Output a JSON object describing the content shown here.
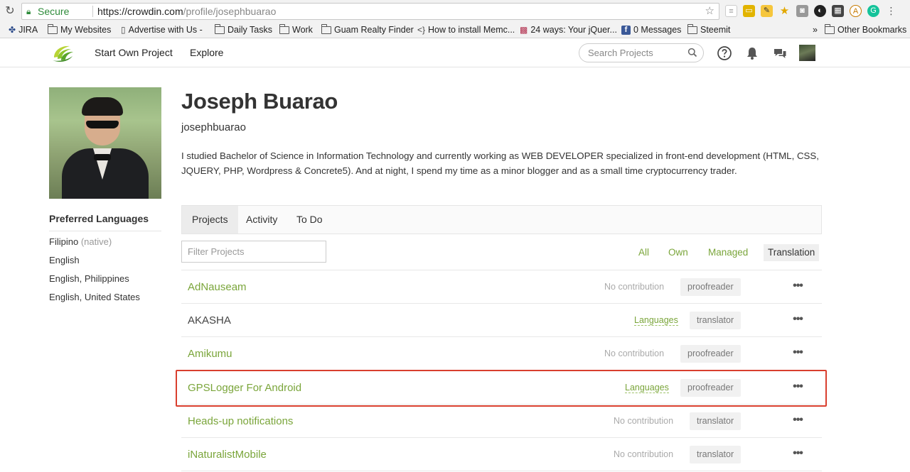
{
  "browser": {
    "secure_label": "Secure",
    "url_host": "https://crowdin.com",
    "url_path": "/profile/josephbuarao"
  },
  "bookmarks": [
    {
      "label": "JIRA",
      "icon": "jira-icon"
    },
    {
      "label": "My Websites",
      "icon": "folder-icon"
    },
    {
      "label": "Advertise with Us -",
      "icon": "page-icon"
    },
    {
      "label": "Daily Tasks",
      "icon": "folder-icon"
    },
    {
      "label": "Work",
      "icon": "folder-icon"
    },
    {
      "label": "Guam Realty Finder",
      "icon": "folder-icon"
    },
    {
      "label": "How to install Memc...",
      "icon": "code-icon"
    },
    {
      "label": "24 ways: Your jQuer...",
      "icon": "pattern-icon"
    },
    {
      "label": "0 Messages",
      "icon": "facebook-icon"
    },
    {
      "label": "Steemit",
      "icon": "folder-icon"
    }
  ],
  "bookmarks_overflow": "»",
  "other_bookmarks": "Other Bookmarks",
  "header": {
    "start_project": "Start Own Project",
    "explore": "Explore",
    "search_placeholder": "Search Projects"
  },
  "profile": {
    "name": "Joseph Buarao",
    "username": "josephbuarao",
    "bio": "I studied Bachelor of Science in Information Technology and currently working as WEB DEVELOPER specialized in front-end development (HTML, CSS, JQUERY, PHP, Wordpress & Concrete5). And at night, I spend my time as a minor blogger and as a small time cryptocurrency trader."
  },
  "preferred_languages": {
    "title": "Preferred Languages",
    "items": [
      {
        "label": "Filipino",
        "note": "(native)"
      },
      {
        "label": "English",
        "note": ""
      },
      {
        "label": "English, Philippines",
        "note": ""
      },
      {
        "label": "English, United States",
        "note": ""
      }
    ]
  },
  "tabs": [
    {
      "label": "Projects",
      "active": true
    },
    {
      "label": "Activity",
      "active": false
    },
    {
      "label": "To Do",
      "active": false
    }
  ],
  "filter": {
    "placeholder": "Filter Projects",
    "options": [
      {
        "label": "All",
        "active": false
      },
      {
        "label": "Own",
        "active": false
      },
      {
        "label": "Managed",
        "active": false
      },
      {
        "label": "Translation",
        "active": true
      }
    ]
  },
  "projects": [
    {
      "name": "AdNauseam",
      "status": "No contribution",
      "role": "proofreader"
    },
    {
      "name": "AKASHA",
      "status": "Languages",
      "role": "translator"
    },
    {
      "name": "Amikumu",
      "status": "No contribution",
      "role": "proofreader"
    },
    {
      "name": "GPSLogger For Android",
      "status": "Languages",
      "role": "proofreader",
      "highlighted": true
    },
    {
      "name": "Heads-up notifications",
      "status": "No contribution",
      "role": "translator"
    },
    {
      "name": "iNaturalistMobile",
      "status": "No contribution",
      "role": "translator"
    }
  ],
  "more_glyph": "•••",
  "colors": {
    "accent": "#7aa53a",
    "highlight": "#d93f2e"
  }
}
